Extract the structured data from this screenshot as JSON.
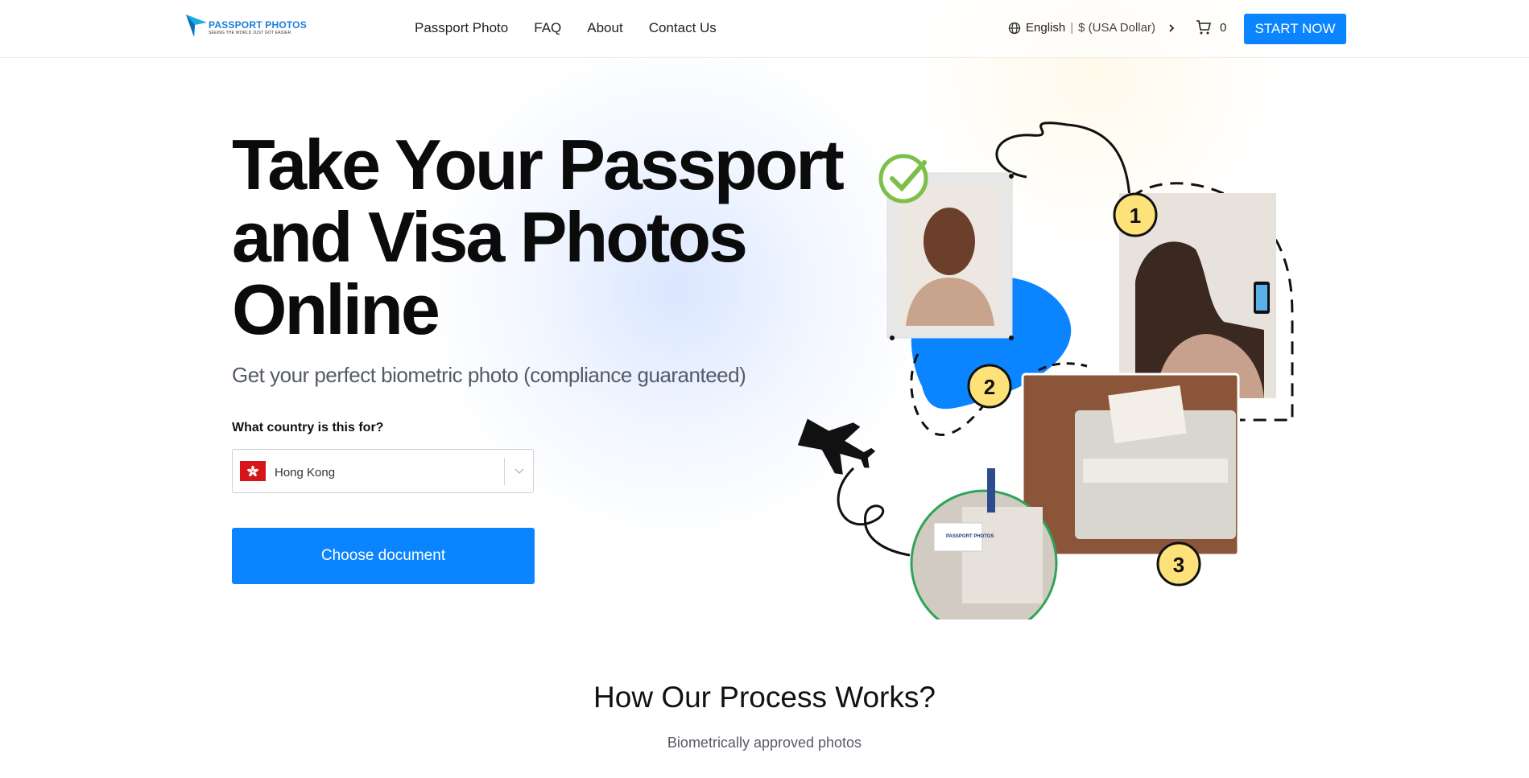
{
  "header": {
    "logo_text": "PASSPORT PHOTOS",
    "logo_tagline": "SEEING THE WORLD JUST GOT EASIER",
    "nav": [
      "Passport Photo",
      "FAQ",
      "About",
      "Contact Us"
    ],
    "language": "English",
    "currency": "$ (USA Dollar)",
    "cart_count": "0",
    "start_label": "START NOW"
  },
  "hero": {
    "title_lines": [
      "Take Your Passport",
      "and Visa Photos",
      "Online"
    ],
    "subtitle": "Get your perfect biometric photo (compliance guaranteed)",
    "country_label": "What country is this for?",
    "country_value": "Hong Kong",
    "choose_label": "Choose document"
  },
  "illustration": {
    "steps": [
      "1",
      "2",
      "3"
    ],
    "card_text": "PASSPORT PHOTOS",
    "colors": {
      "blue_blob": "#0a84ff",
      "step_badge": "#fde27a",
      "check": "#7cbf4a"
    }
  },
  "process": {
    "title": "How Our Process Works?",
    "subtitle": "Biometrically approved photos"
  },
  "colors": {
    "accent": "#0a84ff"
  }
}
